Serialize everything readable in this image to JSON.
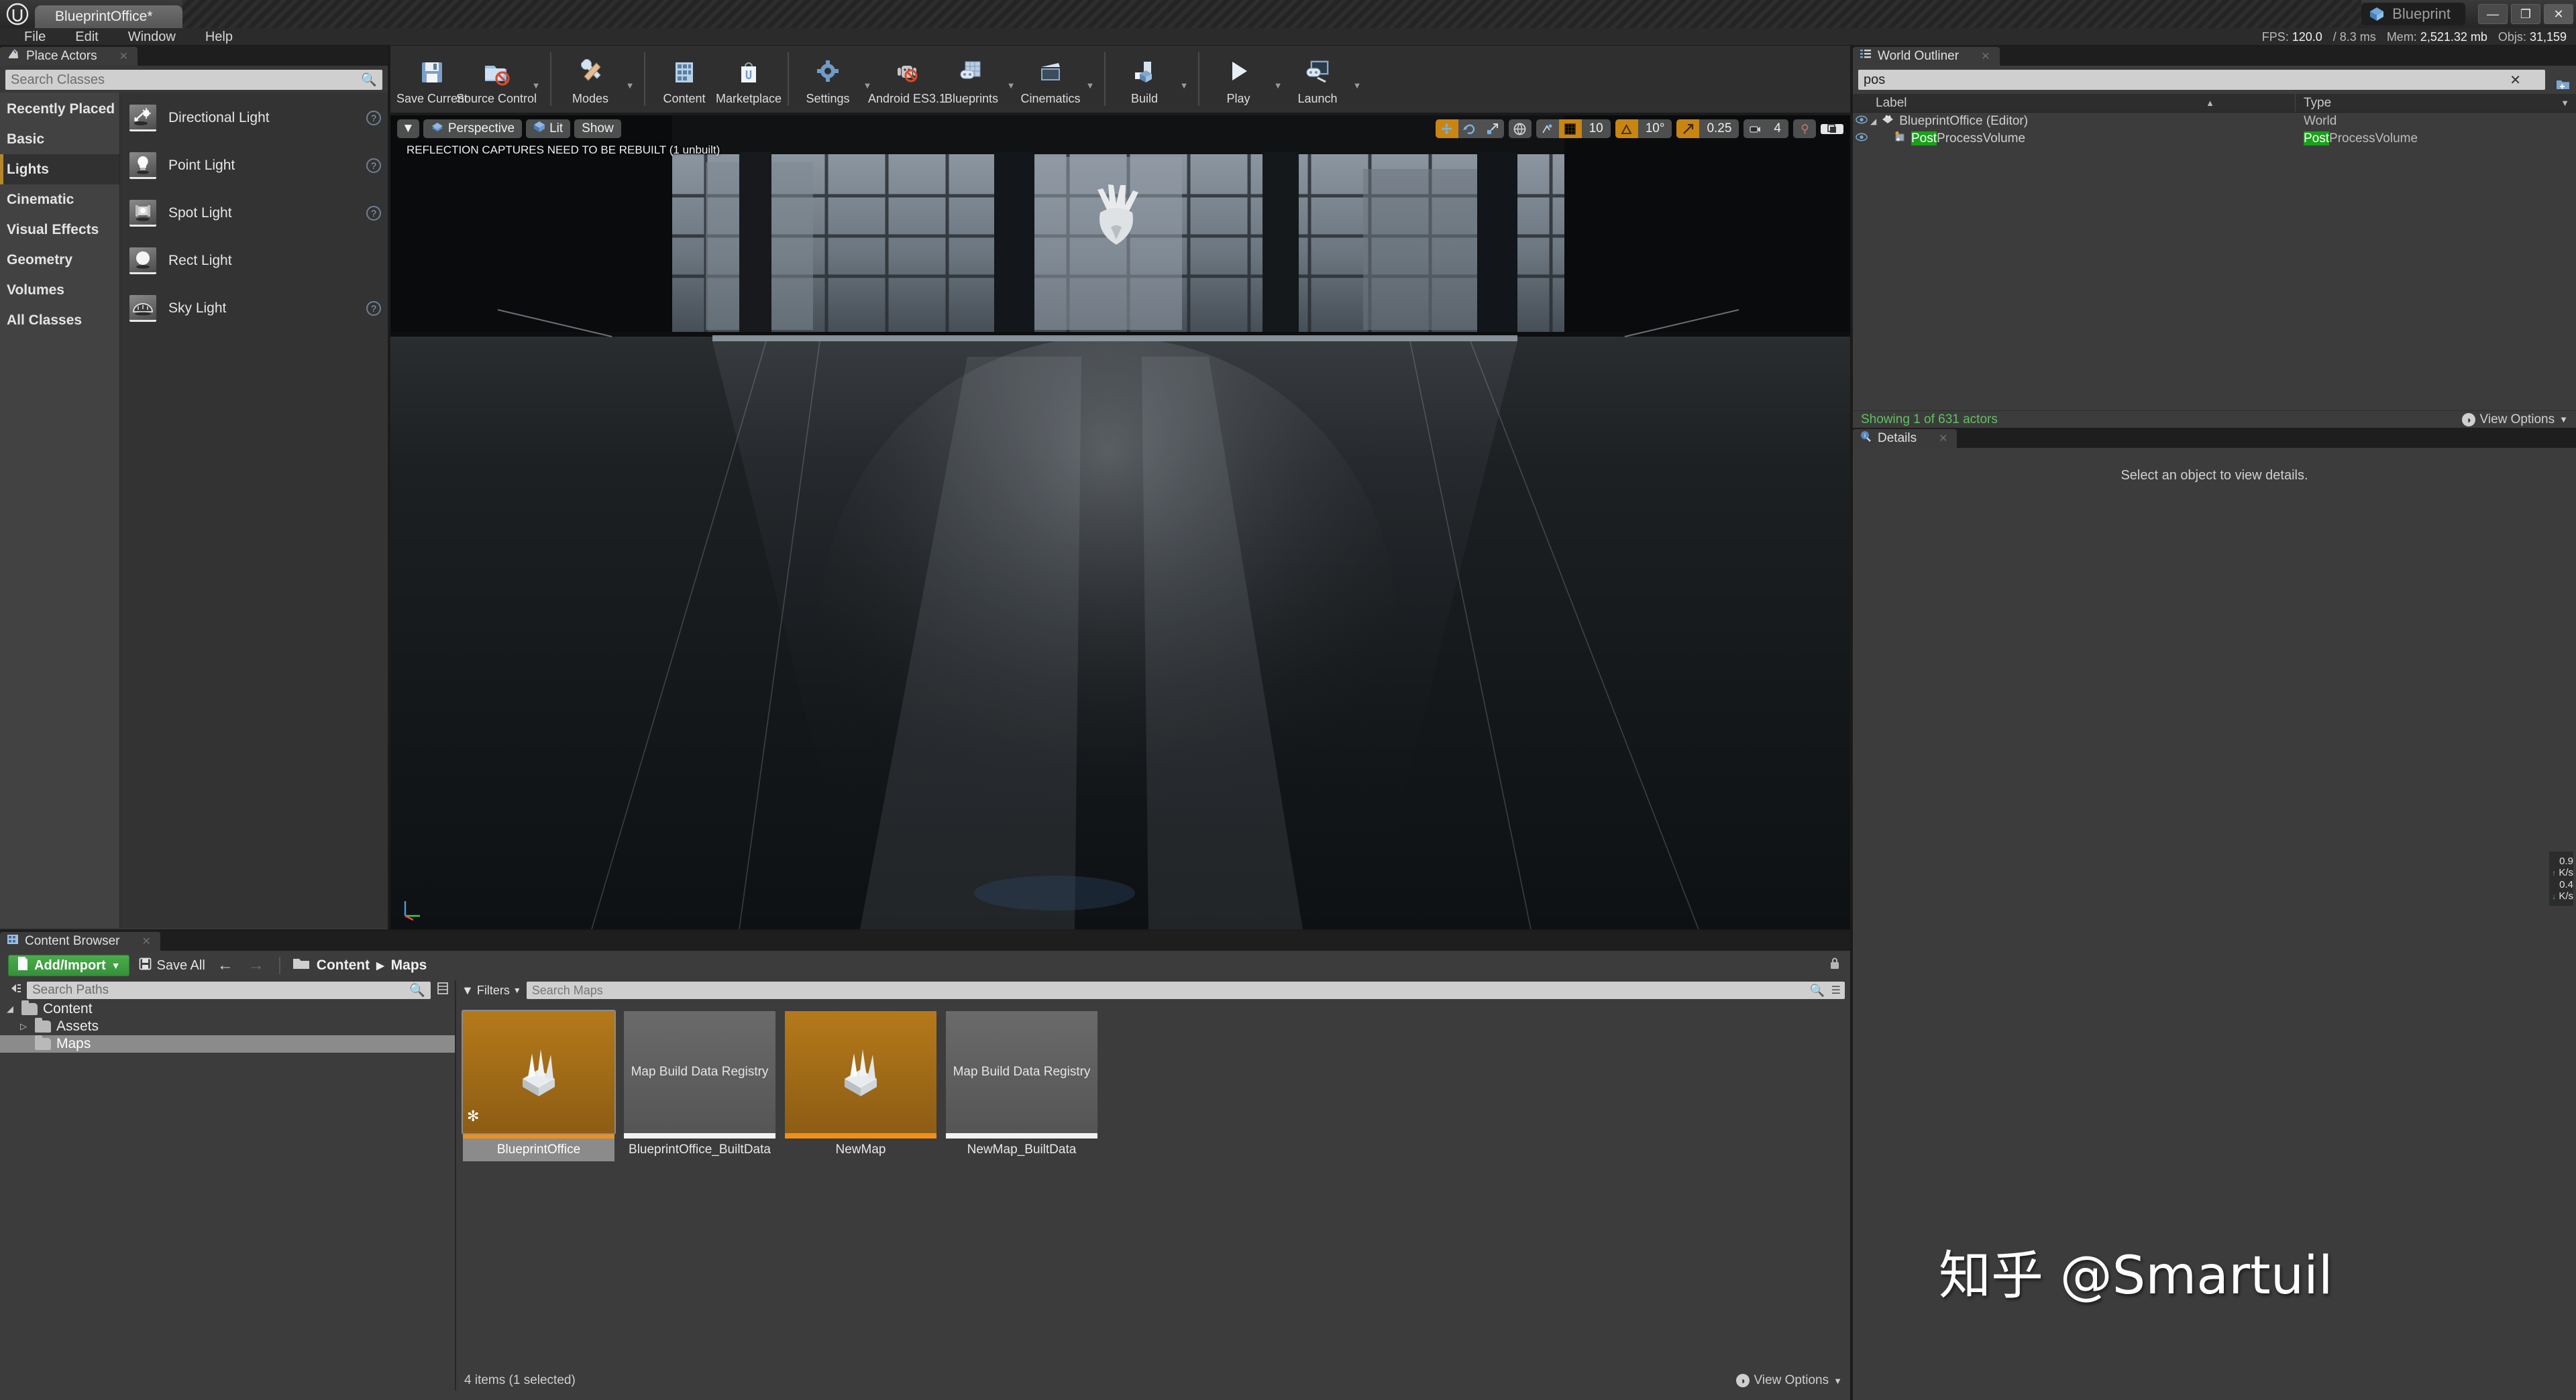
{
  "titlebar": {
    "tab_label": "BlueprintOffice*",
    "badge_label": "Blueprint",
    "minimize": "—",
    "maximize": "❐",
    "close": "✕"
  },
  "menubar": {
    "items": [
      "File",
      "Edit",
      "Window",
      "Help"
    ]
  },
  "stats": {
    "fps_label": "FPS:",
    "fps_value": "120.0",
    "ms_label": "/ 8.3 ms",
    "mem_label": "Mem:",
    "mem_value": "2,521.32 mb",
    "objs_label": "Objs:",
    "objs_value": "31,159"
  },
  "place_actors": {
    "tab_label": "Place Actors",
    "search_placeholder": "Search Classes",
    "categories": [
      {
        "label": "Recently Placed",
        "selected": false
      },
      {
        "label": "Basic",
        "selected": false
      },
      {
        "label": "Lights",
        "selected": true
      },
      {
        "label": "Cinematic",
        "selected": false
      },
      {
        "label": "Visual Effects",
        "selected": false
      },
      {
        "label": "Geometry",
        "selected": false
      },
      {
        "label": "Volumes",
        "selected": false
      },
      {
        "label": "All Classes",
        "selected": false
      }
    ],
    "items": [
      {
        "label": "Directional Light",
        "icon": "directional-light-icon",
        "help": true
      },
      {
        "label": "Point Light",
        "icon": "point-light-icon",
        "help": true
      },
      {
        "label": "Spot Light",
        "icon": "spot-light-icon",
        "help": true
      },
      {
        "label": "Rect Light",
        "icon": "rect-light-icon",
        "help": false
      },
      {
        "label": "Sky Light",
        "icon": "sky-light-icon",
        "help": true
      }
    ]
  },
  "toolbar": {
    "groups": [
      [
        {
          "label": "Save Current",
          "icon": "save-icon",
          "caret": false
        },
        {
          "label": "Source Control",
          "icon": "source-control-icon",
          "caret": true
        }
      ],
      [
        {
          "label": "Modes",
          "icon": "modes-icon",
          "caret": true
        }
      ],
      [
        {
          "label": "Content",
          "icon": "content-icon",
          "caret": false
        },
        {
          "label": "Marketplace",
          "icon": "marketplace-icon",
          "caret": false
        }
      ],
      [
        {
          "label": "Settings",
          "icon": "settings-icon",
          "caret": true
        },
        {
          "label": "Android ES3.1",
          "icon": "android-icon",
          "caret": false
        },
        {
          "label": "Blueprints",
          "icon": "blueprints-icon",
          "caret": true
        },
        {
          "label": "Cinematics",
          "icon": "cinematics-icon",
          "caret": true
        }
      ],
      [
        {
          "label": "Build",
          "icon": "build-icon",
          "caret": true
        }
      ],
      [
        {
          "label": "Play",
          "icon": "play-icon",
          "caret": true
        },
        {
          "label": "Launch",
          "icon": "launch-icon",
          "caret": true
        }
      ]
    ]
  },
  "viewport": {
    "menu_caret": "▼",
    "perspective_label": "Perspective",
    "lit_label": "Lit",
    "show_label": "Show",
    "warning": "REFLECTION CAPTURES NEED TO BE REBUILT (1 unbuilt)",
    "transform_tools": [
      "move-tool",
      "rotate-tool",
      "scale-tool"
    ],
    "coord_tool": "world-space-icon",
    "snap_tools": [
      "surface-snap-icon",
      "grid-snap-icon"
    ],
    "grid_snap_value": "10",
    "angle_snap_value": "10°",
    "scale_snap_value": "0.25",
    "camera_speed_value": "4",
    "eye_icon": "eye-dropper-icon",
    "maximize_icon": "maximize-viewport-icon"
  },
  "outliner": {
    "tab_label": "World Outliner",
    "search_value": "pos",
    "clear_icon": "✕",
    "columns": {
      "label": "Label",
      "type": "Type"
    },
    "rows": [
      {
        "label": "BlueprintOffice (Editor)",
        "type": "World",
        "highlight": "",
        "indent": 0,
        "icon": "level-icon"
      },
      {
        "label": "PostProcessVolume",
        "type": "PostProcessVolume",
        "highlight": "Post",
        "indent": 1,
        "icon": "volume-icon"
      }
    ],
    "footer": "Showing 1 of 631 actors",
    "view_options": "View Options"
  },
  "details": {
    "tab_label": "Details",
    "empty_message": "Select an object to view details."
  },
  "netstats": {
    "up_value": "0.9",
    "up_unit": "K/s",
    "down_value": "0.4",
    "down_unit": "K/s"
  },
  "content_browser": {
    "tab_label": "Content Browser",
    "add_import_label": "Add/Import",
    "save_all_label": "Save All",
    "back_arrow": "←",
    "forward_arrow": "→",
    "breadcrumb": [
      "Content",
      "Maps"
    ],
    "paths_placeholder": "Search Paths",
    "tree": [
      {
        "label": "Content",
        "depth": 0,
        "expanded": true,
        "selected": false
      },
      {
        "label": "Assets",
        "depth": 1,
        "expanded": false,
        "selected": false
      },
      {
        "label": "Maps",
        "depth": 1,
        "expanded": null,
        "selected": true
      }
    ],
    "filters_label": "Filters",
    "assets_placeholder": "Search Maps",
    "assets": [
      {
        "name": "BlueprintOffice",
        "kind": "map",
        "bar": "orange",
        "selected": true,
        "dirty": true,
        "thumb_text": ""
      },
      {
        "name": "BlueprintOffice_BuiltData",
        "kind": "data",
        "bar": "white",
        "selected": false,
        "dirty": false,
        "thumb_text": "Map Build Data Registry"
      },
      {
        "name": "NewMap",
        "kind": "map",
        "bar": "orange",
        "selected": false,
        "dirty": false,
        "thumb_text": ""
      },
      {
        "name": "NewMap_BuiltData",
        "kind": "data",
        "bar": "white",
        "selected": false,
        "dirty": false,
        "thumb_text": "Map Build Data Registry"
      }
    ],
    "status": "4 items (1 selected)",
    "view_options": "View Options"
  },
  "watermark": {
    "text": "知乎 @Smartuil"
  },
  "colors": {
    "accent_orange": "#f0901a",
    "green_add": "#3fa444",
    "highlight_green": "#19a119",
    "panel_bg": "#3c3c3c"
  }
}
